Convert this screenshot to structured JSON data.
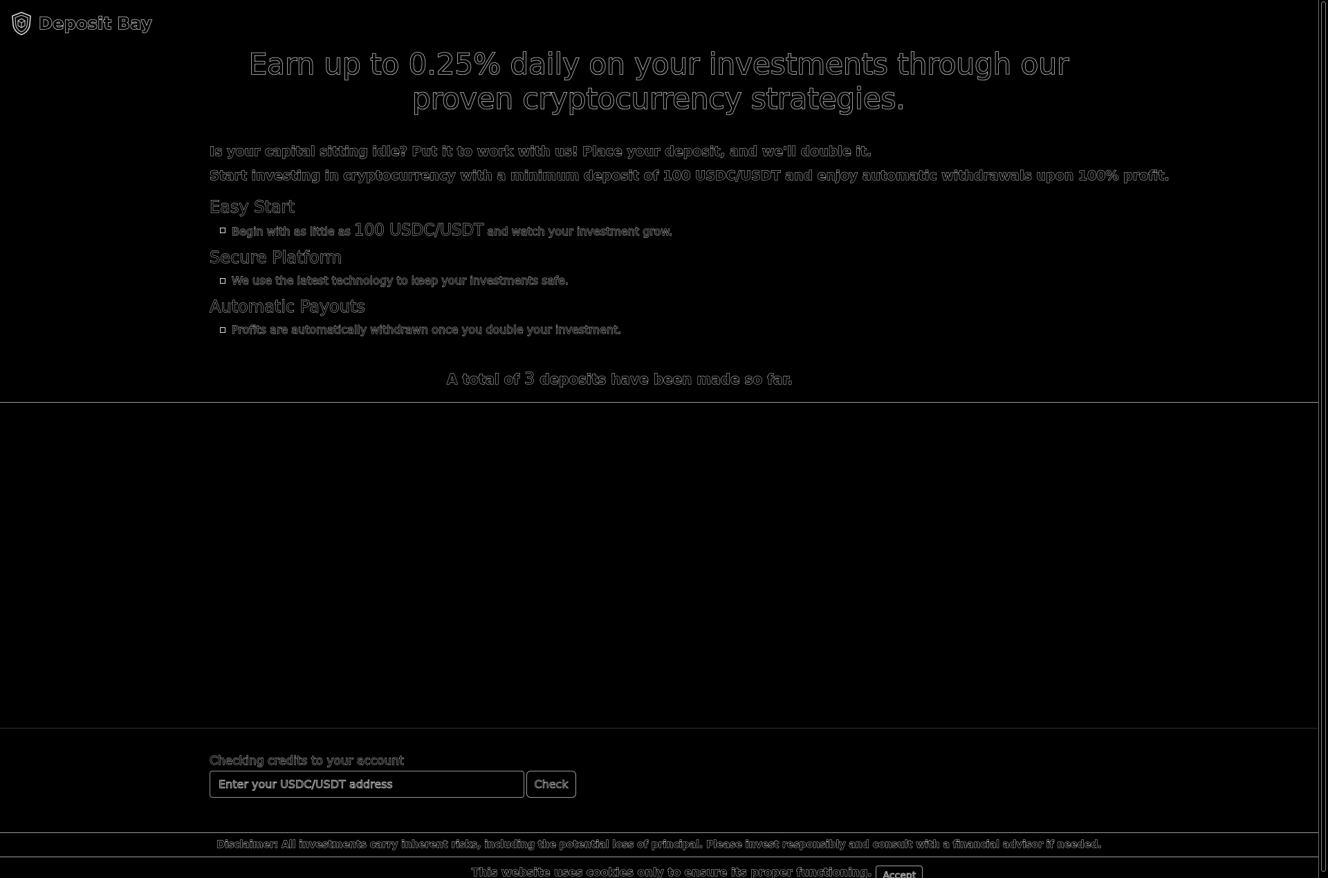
{
  "header": {
    "brand": "Deposit Bay",
    "logo_icon": "shield-logo-icon"
  },
  "hero": {
    "title": "Earn up to 0.25% daily on your investments through our proven cryptocurrency strategies."
  },
  "intro": {
    "line1": "Is your capital sitting idle? Put it to work with us! Place your deposit, and we'll double it.",
    "line2": "Start investing in cryptocurrency with a minimum deposit of 100 USDC/USDT and enjoy automatic withdrawals upon 100% profit."
  },
  "features": [
    {
      "title": "Easy Start",
      "text_before": "Begin with as little as ",
      "highlight": "100 USDC/USDT",
      "text_after": " and watch your investment grow."
    },
    {
      "title": "Secure Platform",
      "text": "We use the latest technology to keep your investments safe."
    },
    {
      "title": "Automatic Payouts",
      "text": "Profits are automatically withdrawn once you double your investment."
    }
  ],
  "deposits": {
    "prefix": "A total of ",
    "count": "3",
    "suffix": " deposits have been made so far."
  },
  "check": {
    "label": "Checking credits to your account",
    "placeholder": "Enter your USDC/USDT address",
    "button": "Check"
  },
  "disclaimer": {
    "text": "Disclaimer: All investments carry inherent risks, including the potential loss of principal. Please invest responsibly and consult with a financial advisor if needed."
  },
  "cookie": {
    "text": "This website uses cookies only to ensure its proper functioning.",
    "accept": "Accept"
  },
  "colors": {
    "background": "#000000",
    "outline": "#e6e6e6"
  }
}
